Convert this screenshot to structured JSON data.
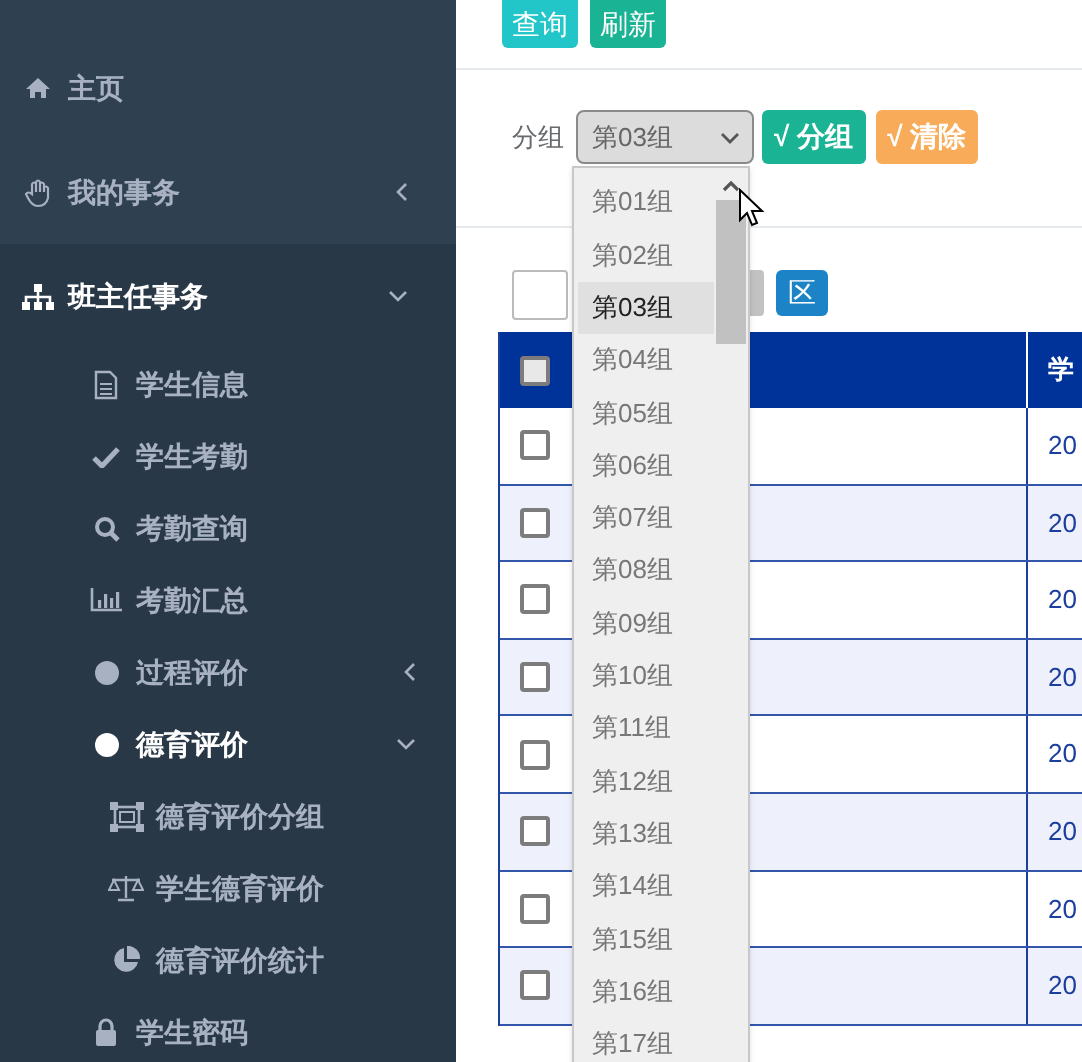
{
  "sidebar": {
    "items": [
      {
        "label": "主页"
      },
      {
        "label": "我的事务",
        "expanded": false
      },
      {
        "label": "班主任事务",
        "expanded": true,
        "children": [
          {
            "label": "学生信息"
          },
          {
            "label": "学生考勤"
          },
          {
            "label": "考勤查询"
          },
          {
            "label": "考勤汇总"
          },
          {
            "label": "过程评价",
            "expanded": false
          },
          {
            "label": "德育评价",
            "expanded": true,
            "children": [
              {
                "label": "德育评价分组"
              },
              {
                "label": "学生德育评价"
              },
              {
                "label": "德育评价统计"
              }
            ]
          },
          {
            "label": "学生密码"
          }
        ]
      }
    ]
  },
  "toolbar": {
    "buttons": [
      "查询",
      "刷新"
    ]
  },
  "filter": {
    "label": "分组",
    "select": {
      "value": "第03组",
      "options": [
        {
          "label": "第01组",
          "selected": false
        },
        {
          "label": "第02组",
          "selected": false
        },
        {
          "label": "第03组",
          "selected": true
        },
        {
          "label": "第04组",
          "selected": false
        },
        {
          "label": "第05组",
          "selected": false
        },
        {
          "label": "第06组",
          "selected": false
        },
        {
          "label": "第07组",
          "selected": false
        },
        {
          "label": "第08组",
          "selected": false
        },
        {
          "label": "第09组",
          "selected": false
        },
        {
          "label": "第10组",
          "selected": false
        },
        {
          "label": "第11组",
          "selected": false
        },
        {
          "label": "第12组",
          "selected": false
        },
        {
          "label": "第13组",
          "selected": false
        },
        {
          "label": "第14组",
          "selected": false
        },
        {
          "label": "第15组",
          "selected": false
        },
        {
          "label": "第16组",
          "selected": false
        },
        {
          "label": "第17组",
          "selected": false
        }
      ]
    },
    "buttons": [
      {
        "label": "√ 分组",
        "kind": "primary"
      },
      {
        "label": "√ 清除",
        "kind": "warning"
      }
    ]
  },
  "actions": {
    "buttons": [
      {
        "label": "区",
        "kind": "info"
      }
    ]
  },
  "table": {
    "header": {
      "checked": false,
      "column_3": "学"
    },
    "rows": [
      {
        "checked": false,
        "column_3": "20"
      },
      {
        "checked": false,
        "column_3": "20"
      },
      {
        "checked": false,
        "column_3": "20"
      },
      {
        "checked": false,
        "column_3": "20"
      },
      {
        "checked": false,
        "column_3": "20"
      },
      {
        "checked": false,
        "column_3": "20"
      },
      {
        "checked": false,
        "column_3": "20"
      },
      {
        "checked": false,
        "column_3": "20"
      }
    ]
  }
}
